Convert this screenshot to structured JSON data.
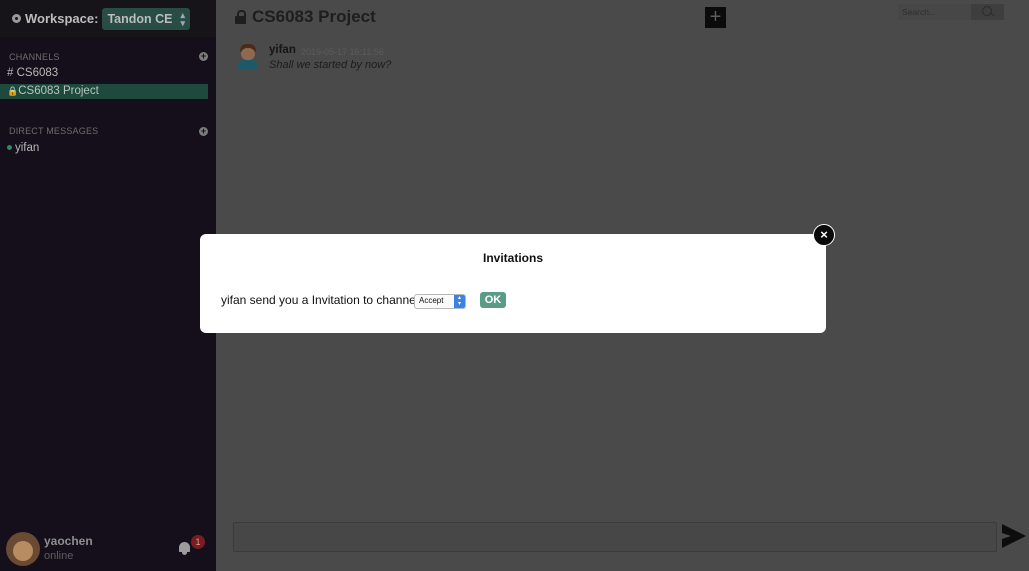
{
  "workspace": {
    "label": "Workspace:",
    "selected": "Tandon CE"
  },
  "channels": {
    "header": "CHANNELS",
    "items": [
      {
        "label": "# CS6083",
        "active": false
      },
      {
        "label": "CS6083 Project",
        "active": true,
        "icon": "lock-icon"
      }
    ]
  },
  "direct_messages": {
    "header": "DIRECT MESSAGES",
    "items": [
      {
        "label": "yifan",
        "status": "online"
      }
    ]
  },
  "current_user": {
    "name": "yaochen",
    "status": "online",
    "notification_count": "1"
  },
  "header": {
    "channel_title": "CS6083 Project",
    "add_button": "+",
    "search_placeholder": "Search..."
  },
  "messages": [
    {
      "author": "yifan",
      "timestamp": "2019-05-17 16:11:56",
      "text": "Shall we started by now?"
    }
  ],
  "composer": {
    "value": ""
  },
  "modal": {
    "title": "Invitations",
    "text": "yifan send you a Invitation to channel:",
    "select_value": "Accept",
    "ok_label": "OK",
    "close_label": "×"
  },
  "colors": {
    "sidebar_bg": "#140f1a",
    "active_channel": "#1e4a3d",
    "ok_button": "#5a9b88",
    "badge": "#7a1d21"
  }
}
